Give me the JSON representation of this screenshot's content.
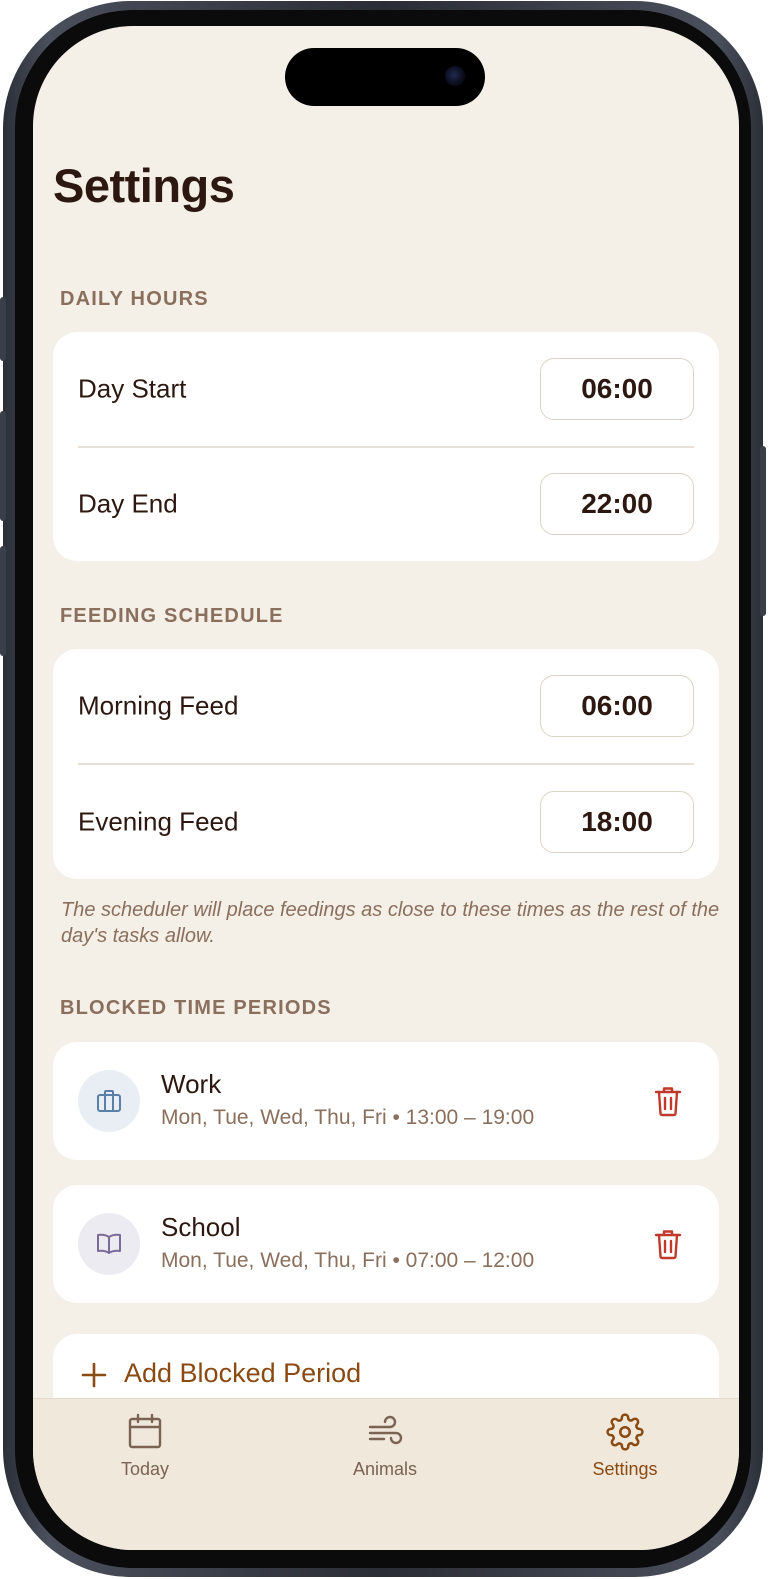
{
  "header": {
    "title": "Settings"
  },
  "daily_hours": {
    "section_label": "DAILY HOURS",
    "day_start": {
      "label": "Day Start",
      "value": "06:00"
    },
    "day_end": {
      "label": "Day End",
      "value": "22:00"
    }
  },
  "feeding_schedule": {
    "section_label": "FEEDING SCHEDULE",
    "morning": {
      "label": "Morning Feed",
      "value": "06:00"
    },
    "evening": {
      "label": "Evening Feed",
      "value": "18:00"
    },
    "note": "The scheduler will place feedings as close to these times as the rest of the day's tasks allow."
  },
  "blocked_periods": {
    "section_label": "BLOCKED TIME PERIODS",
    "items": [
      {
        "name": "Work",
        "detail": "Mon, Tue, Wed, Thu, Fri • 13:00 – 19:00",
        "icon": "briefcase-icon",
        "icon_color": "#5a7fa8",
        "icon_bg": "#e9eef5"
      },
      {
        "name": "School",
        "detail": "Mon, Tue, Wed, Thu, Fri • 07:00 – 12:00",
        "icon": "book-icon",
        "icon_color": "#7a6a9a",
        "icon_bg": "#ecebf1"
      }
    ],
    "add_label": "Add Blocked Period"
  },
  "tabbar": {
    "today": "Today",
    "animals": "Animals",
    "settings": "Settings"
  },
  "colors": {
    "background": "#f4efe7",
    "accent": "#8a4a12",
    "danger": "#c0392b",
    "text": "#2c1810",
    "muted": "#8a6f5c"
  }
}
